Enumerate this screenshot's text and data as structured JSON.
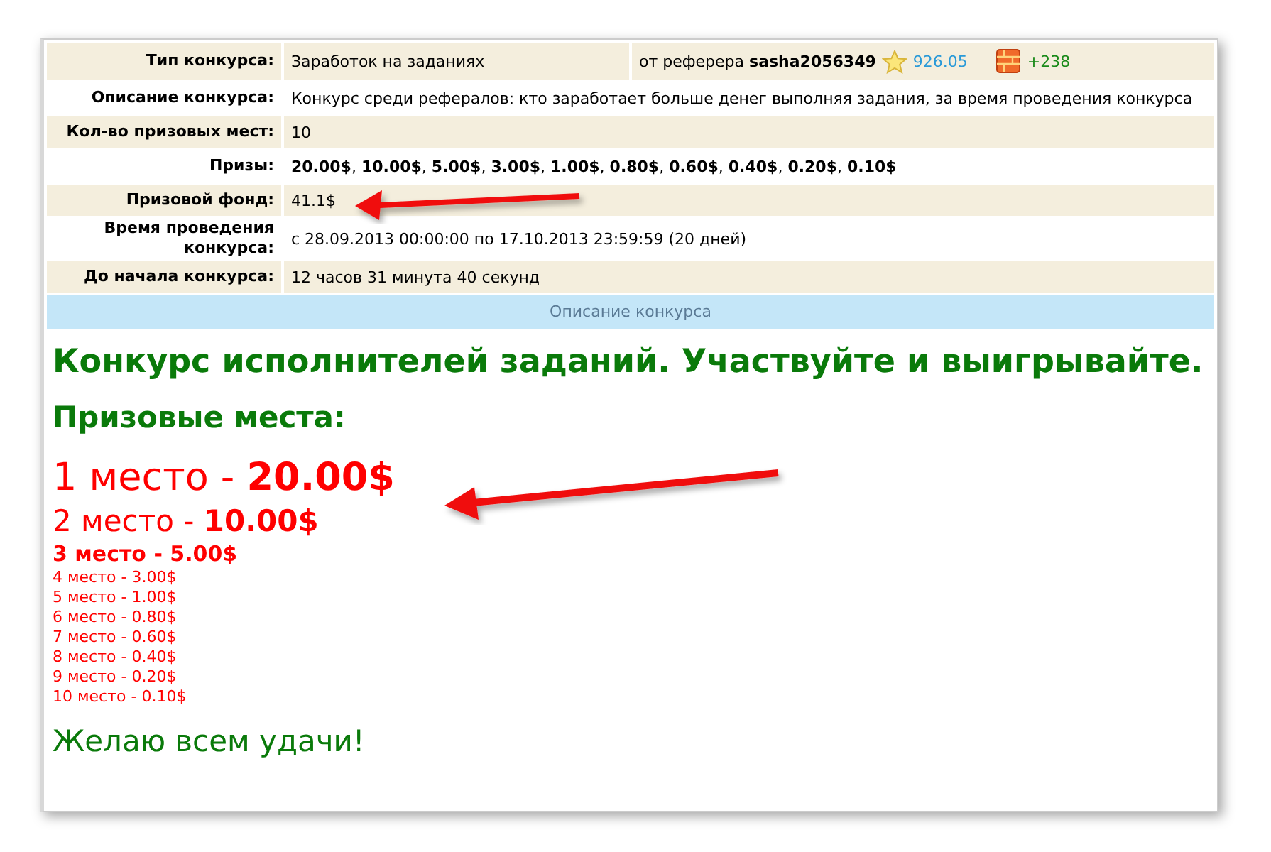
{
  "contest_info": {
    "rows": [
      {
        "label": "Тип конкурса:",
        "value": "Заработок на заданиях",
        "referrer": {
          "text": "от реферера **sasha2056349**",
          "rating": "926.05",
          "bonus": "+238"
        }
      },
      {
        "label": "Описание конкурса:",
        "value": "Конкурс среди рефералов: кто заработает больше денег выполняя задания, за время проведения конкурса"
      },
      {
        "label": "Кол-во призовых мест:",
        "value": "10"
      },
      {
        "label": "Призы:",
        "value": "**20.00$**, **10.00$**, **5.00$**, **3.00$**, **1.00$**, **0.80$**, **0.60$**, **0.40$**, **0.20$**, **0.10$**"
      },
      {
        "label": "Призовой фонд:",
        "value": "41.1$"
      },
      {
        "label": "Время проведения конкурса:",
        "value": "с 28.09.2013 00:00:00 по 17.10.2013 23:59:59 (20 дней)"
      },
      {
        "label": "До начала конкурса:",
        "value": "12 часов 31 минута 40 секунд"
      }
    ]
  },
  "description_header": "Описание конкурса",
  "description": {
    "title": "Конкурс исполнителей заданий. Участвуйте и выигрывайте.",
    "subtitle": "Призовые места:",
    "places": [
      {
        "kind": "large",
        "text": "1 место - **20.00$**"
      },
      {
        "kind": "medium",
        "text": "2 место - **10.00$**"
      },
      {
        "kind": "bold",
        "text": "3 место - 5.00$"
      },
      {
        "kind": "small",
        "text": "4 место - 3.00$"
      },
      {
        "kind": "small",
        "text": "5 место - 1.00$"
      },
      {
        "kind": "small",
        "text": "6 место - 0.80$"
      },
      {
        "kind": "small",
        "text": "7 место - 0.60$"
      },
      {
        "kind": "small",
        "text": "8 место - 0.40$"
      },
      {
        "kind": "small",
        "text": "9 место - 0.20$"
      },
      {
        "kind": "small",
        "text": "10 место - 0.10$"
      }
    ],
    "closing": "Желаю всем удачи!"
  }
}
